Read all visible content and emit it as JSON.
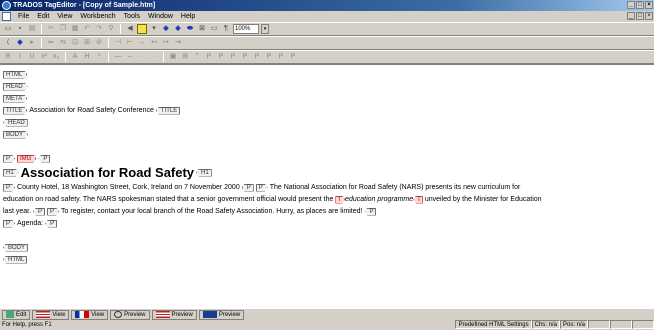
{
  "window": {
    "title": "TRADOS TagEditor - [Copy of Sample.htm]",
    "controls": [
      "_",
      "□",
      "×"
    ]
  },
  "menu": {
    "items": [
      "File",
      "Edit",
      "View",
      "Workbench",
      "Tools",
      "Window",
      "Help"
    ]
  },
  "toolbar": {
    "zoom": "100%",
    "zoom_dropdown": "▾"
  },
  "document": {
    "tags": {
      "html": "HTML",
      "head": "HEAD",
      "meta": "META",
      "title": "TITLE",
      "body": "BODY",
      "p": "P",
      "img": "IMG",
      "h1": "H1",
      "b": "B",
      "i": "I"
    },
    "title_text": "Association for Road Safety Conference",
    "heading": "Association for Road Safety",
    "para1_line1": "County Hotel, 18 Washington Street, Cork, Ireland on 7 November 2000",
    "para2_line1": "The National Association for Road Safety (NARS) presents its new curriculum for",
    "para2_line2a": "education on road safety. The NARS spokesman stated that a senior government official would present the",
    "para2_italic": "education programme",
    "para2_line2b": "unveiled by the Minister for Education",
    "para2_line3a": "last year.",
    "para3_text": "To register, contact your local branch of the Road Safety Association. Hurry, as places are limited!",
    "agenda": "Agenda:"
  },
  "view_tabs": [
    {
      "label": "Edit",
      "icon": "edit-icon"
    },
    {
      "label": "View",
      "icon": "us-flag-icon"
    },
    {
      "label": "View",
      "icon": "fr-flag-icon"
    },
    {
      "label": "Preview",
      "icon": "search-preview-icon"
    },
    {
      "label": "Preview",
      "icon": "us-flag-icon"
    },
    {
      "label": "Preview",
      "icon": "uk-flag-icon"
    }
  ],
  "status": {
    "help": "For Help, press F1",
    "settings": "Predefined HTML Settings",
    "chars": "Chs: n/a",
    "pos": "Pos: n/a"
  }
}
